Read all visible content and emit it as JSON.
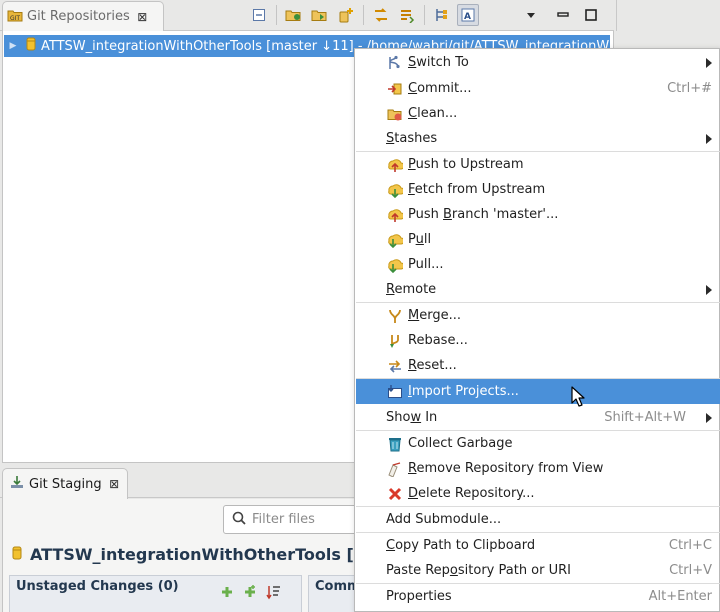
{
  "colors": {
    "selection": "#4a90d9",
    "window_bg": "#e8e8e7",
    "section_title": "#23384f"
  },
  "repositories_view": {
    "tab_title": "Git Repositories",
    "tab_icon": "git-repositories-icon",
    "close_glyph": "⊠",
    "toolbar": [
      "collapse-all-icon",
      "add-existing-repository-icon",
      "clone-repository-icon",
      "create-repository-icon",
      "fetch-icon",
      "pull-icon",
      "hierarchical-layout-icon",
      "link-with-editor-icon"
    ],
    "view_menu": [
      "view-menu-icon",
      "minimize-icon",
      "maximize-icon"
    ],
    "selected_repository": {
      "label": "ATTSW_integrationWithOtherTools [master ↓11] - /home/wabri/git/ATTSW_integrationW"
    }
  },
  "staging_view": {
    "tab_title": "Git Staging",
    "close_glyph": "⊠",
    "filter_placeholder": "Filter files",
    "repo_title": "ATTSW_integrationWithOtherTools [",
    "unstaged_title": "Unstaged Changes (0)",
    "commit_title": "Comm"
  },
  "context_menu": {
    "items": [
      {
        "label_pre": "",
        "mnemonic": "S",
        "label_post": "witch To",
        "icon": "switch-to-icon",
        "accel": "",
        "submenu": true
      },
      {
        "label_pre": "",
        "mnemonic": "C",
        "label_post": "ommit...",
        "icon": "commit-icon",
        "accel": "Ctrl+#",
        "submenu": false
      },
      {
        "label_pre": "",
        "mnemonic": "C",
        "label_post": "lean...",
        "icon": "clean-icon",
        "accel": "",
        "submenu": false
      },
      {
        "label_pre": "",
        "mnemonic": "S",
        "label_post": "tashes",
        "icon": "",
        "accel": "",
        "submenu": true
      },
      {
        "label_pre": "",
        "mnemonic": "P",
        "label_post": "ush to Upstream",
        "icon": "push-upstream-icon",
        "accel": "",
        "submenu": false
      },
      {
        "label_pre": "",
        "mnemonic": "F",
        "label_post": "etch from Upstream",
        "icon": "fetch-upstream-icon",
        "accel": "",
        "submenu": false
      },
      {
        "label_pre": "Push ",
        "mnemonic": "B",
        "label_post": "ranch 'master'...",
        "icon": "push-branch-icon",
        "accel": "",
        "submenu": false
      },
      {
        "label_pre": "P",
        "mnemonic": "u",
        "label_post": "ll",
        "icon": "pull-icon",
        "accel": "",
        "submenu": false
      },
      {
        "label_pre": "Pull...",
        "mnemonic": "",
        "label_post": "",
        "icon": "pull-dialog-icon",
        "accel": "",
        "submenu": false
      },
      {
        "label_pre": "",
        "mnemonic": "R",
        "label_post": "emote",
        "icon": "",
        "accel": "",
        "submenu": true
      },
      {
        "label_pre": "",
        "mnemonic": "M",
        "label_post": "erge...",
        "icon": "merge-icon",
        "accel": "",
        "submenu": false
      },
      {
        "label_pre": "Rebase...",
        "mnemonic": "",
        "label_post": "",
        "icon": "rebase-icon",
        "accel": "",
        "submenu": false
      },
      {
        "label_pre": "",
        "mnemonic": "R",
        "label_post": "eset...",
        "icon": "reset-icon",
        "accel": "",
        "submenu": false
      },
      {
        "label_pre": "",
        "mnemonic": "I",
        "label_post": "mport Projects...",
        "icon": "import-projects-icon",
        "accel": "",
        "submenu": false
      },
      {
        "label_pre": "Sho",
        "mnemonic": "w",
        "label_post": " In",
        "icon": "",
        "accel": "Shift+Alt+W",
        "submenu": true
      },
      {
        "label_pre": "Collect Garbage",
        "mnemonic": "",
        "label_post": "",
        "icon": "collect-garbage-icon",
        "accel": "",
        "submenu": false
      },
      {
        "label_pre": "",
        "mnemonic": "R",
        "label_post": "emove Repository from View",
        "icon": "remove-repository-icon",
        "accel": "",
        "submenu": false
      },
      {
        "label_pre": "",
        "mnemonic": "D",
        "label_post": "elete Repository...",
        "icon": "delete-repository-icon",
        "accel": "",
        "submenu": false
      },
      {
        "label_pre": "Add Submodule...",
        "mnemonic": "",
        "label_post": "",
        "icon": "",
        "accel": "",
        "submenu": false
      },
      {
        "label_pre": "",
        "mnemonic": "C",
        "label_post": "opy Path to Clipboard",
        "icon": "",
        "accel": "Ctrl+C",
        "submenu": false
      },
      {
        "label_pre": "Paste Rep",
        "mnemonic": "o",
        "label_post": "sitory Path or URI",
        "icon": "",
        "accel": "Ctrl+V",
        "submenu": false
      },
      {
        "label_pre": "Properties",
        "mnemonic": "",
        "label_post": "",
        "icon": "",
        "accel": "Alt+Enter",
        "submenu": false
      }
    ],
    "highlighted": "Import Projects..."
  }
}
